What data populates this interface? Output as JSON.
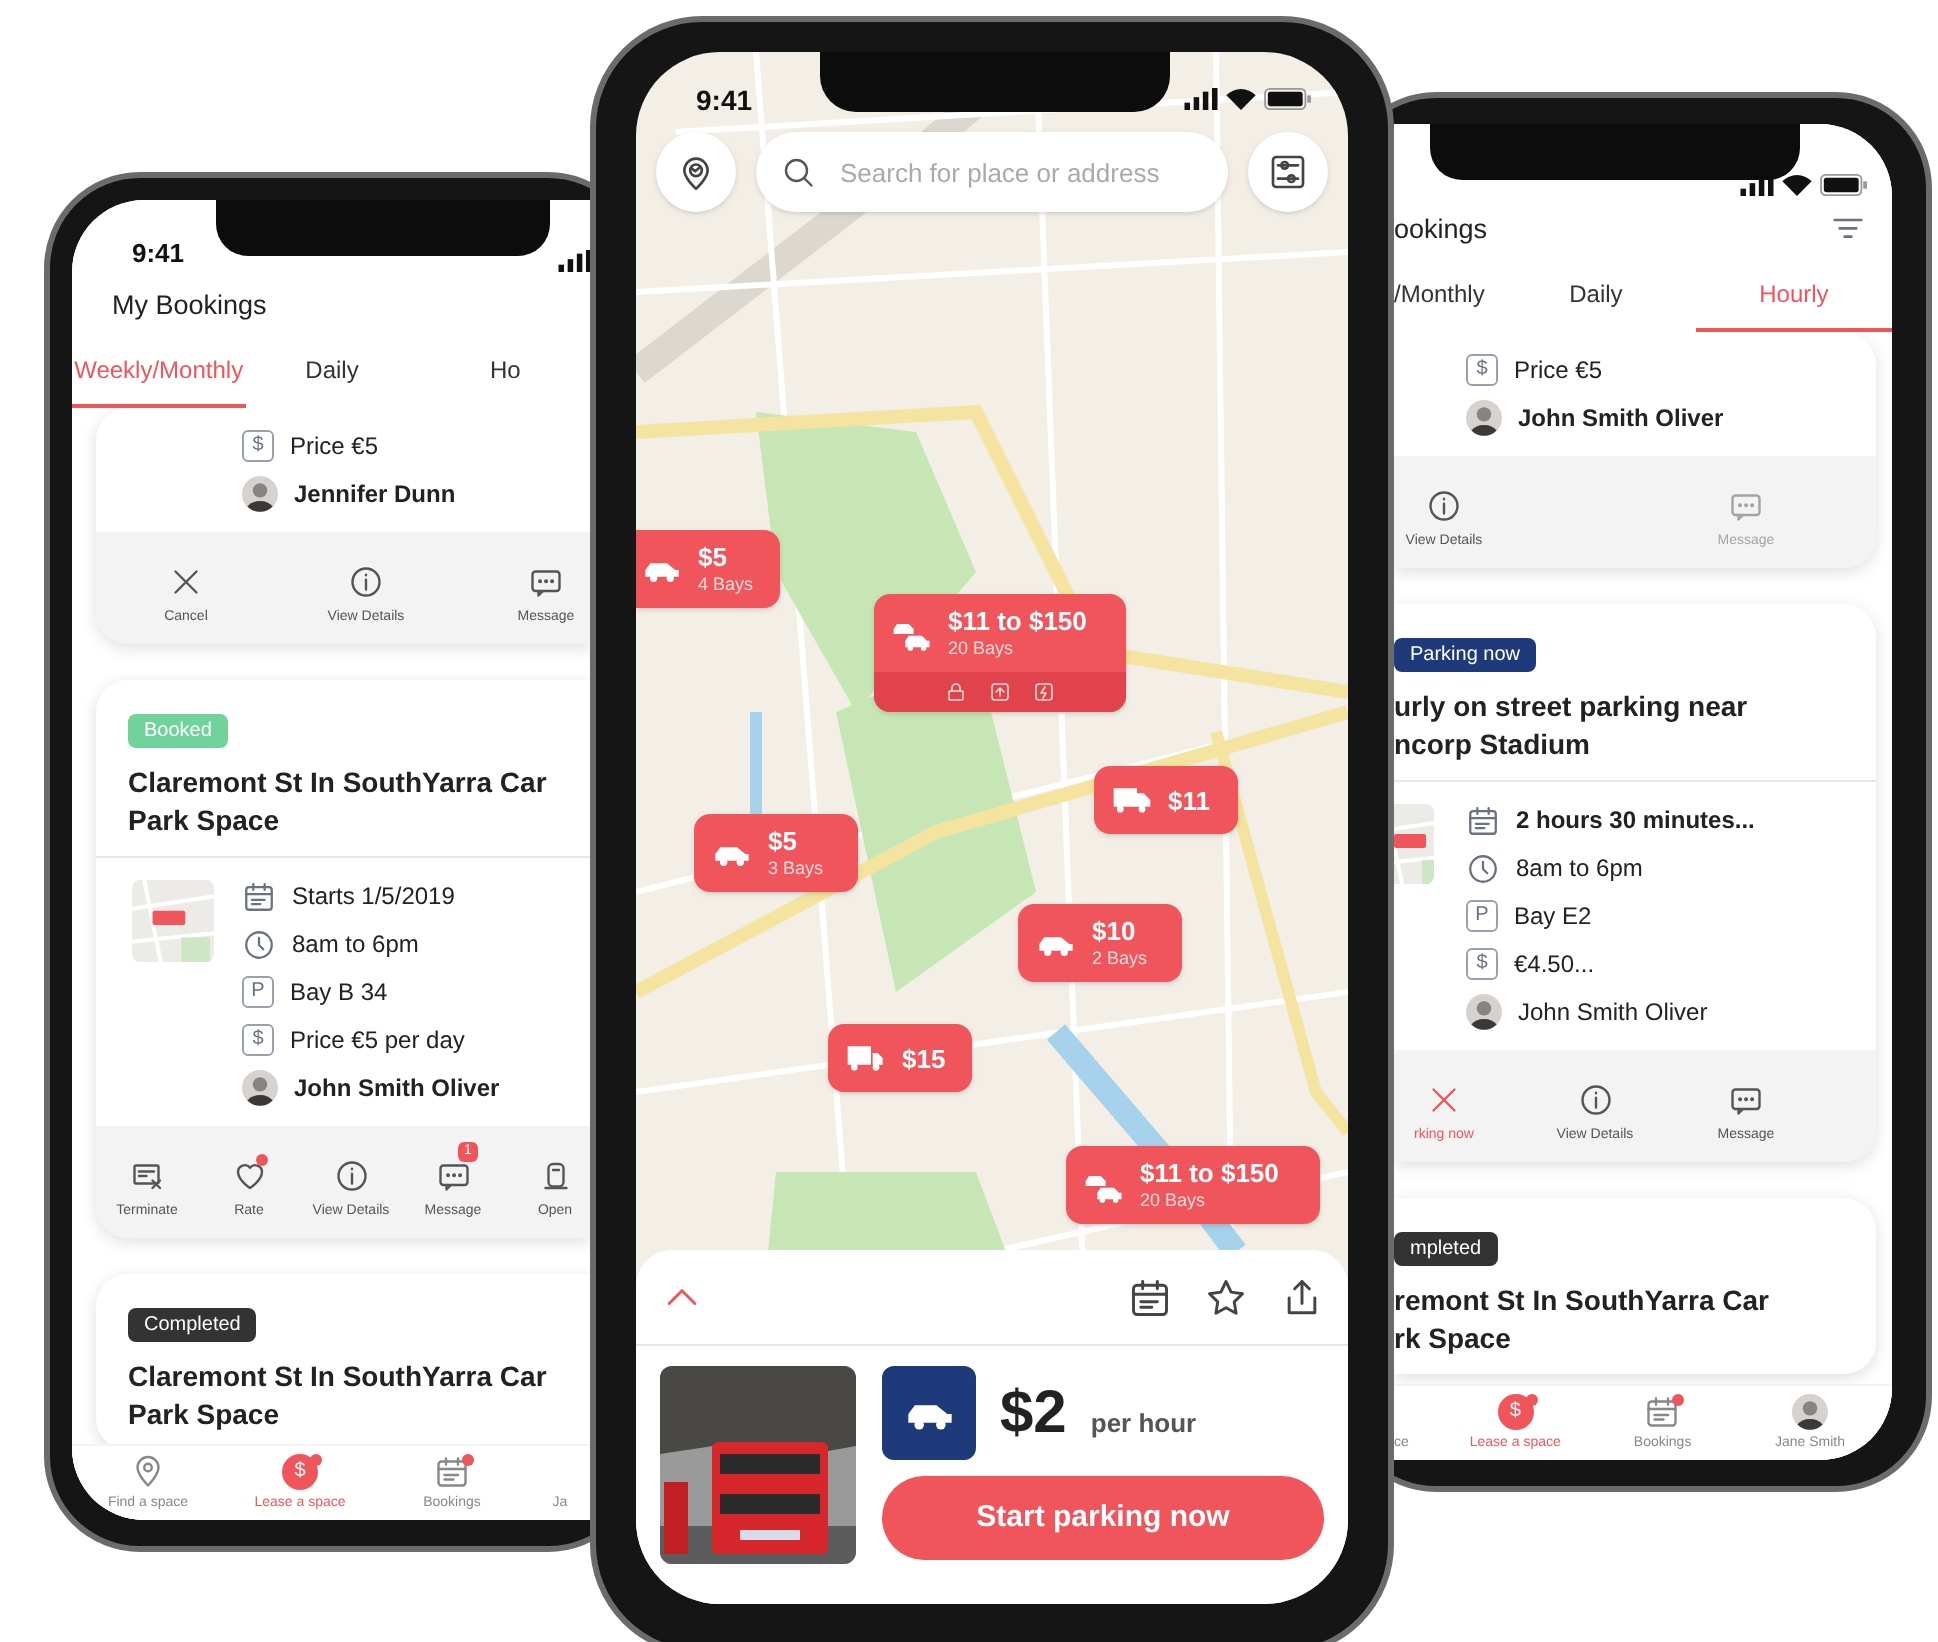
{
  "phones": [
    {
      "kind": "bookings",
      "status_time": "9:41",
      "title": "My Bookings",
      "tabs": [
        {
          "label": "Weekly/Monthly",
          "selected": true
        },
        {
          "label": "Daily",
          "selected": false
        },
        {
          "label": "Ho",
          "selected": false
        }
      ],
      "cards": [
        {
          "details": [
            {
              "kind": "sign",
              "glyph": "$",
              "text": "Price €5",
              "bold": false
            },
            {
              "kind": "person",
              "text": "Jennifer Dunn",
              "bold": true
            }
          ],
          "actions": [
            {
              "kind": "close",
              "label": "Cancel",
              "disabled": false,
              "highlighted": false,
              "dot": false
            },
            {
              "kind": "info",
              "label": "View Details",
              "disabled": false,
              "highlighted": false,
              "dot": false
            },
            {
              "kind": "message",
              "label": "Message",
              "disabled": false,
              "highlighted": false,
              "dot": false
            }
          ]
        },
        {
          "status": {
            "label": "Booked",
            "kind": "booked"
          },
          "title": [
            "Claremont St In SouthYarra Car",
            "Park Space"
          ],
          "thumbnail": {
            "kind": "picture"
          },
          "details": [
            {
              "kind": "calendar",
              "text": "Starts 1/5/2019",
              "bold": false
            },
            {
              "kind": "clock",
              "text": "8am to 6pm",
              "bold": false
            },
            {
              "kind": "sign",
              "glyph": "P",
              "text": "Bay B 34",
              "bold": false
            },
            {
              "kind": "sign",
              "glyph": "$",
              "text": "Price €5 per day",
              "bold": false
            },
            {
              "kind": "person",
              "text": "John Smith Oliver",
              "bold": true
            }
          ],
          "actions": [
            {
              "kind": "terminate",
              "label": "Terminate",
              "disabled": false,
              "highlighted": false,
              "dot": false
            },
            {
              "kind": "heart",
              "label": "Rate",
              "disabled": false,
              "highlighted": false,
              "dot": true
            },
            {
              "kind": "info",
              "label": "View Details",
              "disabled": false,
              "highlighted": false,
              "dot": false
            },
            {
              "kind": "message",
              "label": "Message",
              "disabled": false,
              "highlighted": false,
              "dot": false,
              "badge": "1"
            },
            {
              "kind": "barrier",
              "label": "Open",
              "disabled": false,
              "highlighted": false,
              "dot": false
            }
          ]
        },
        {
          "status": {
            "label": "Completed",
            "kind": "completed"
          },
          "title": [
            "Claremont St In SouthYarra Car",
            "Park Space"
          ]
        }
      ],
      "nav": [
        {
          "kind": "pin",
          "label": "Find a space",
          "selected": false,
          "dot": false
        },
        {
          "kind": "coin",
          "glyph": "$",
          "label": "Lease a space",
          "selected": true,
          "dot": true
        },
        {
          "kind": "bookings",
          "label": "Bookings",
          "selected": false,
          "dot": true
        },
        {
          "label": "Ja",
          "selected": false,
          "dot": false
        }
      ]
    },
    {
      "kind": "map",
      "status_time": "9:41",
      "search": {
        "placeholder": "Search for place or address"
      },
      "map": {
        "kind": "picture"
      },
      "markers": [
        {
          "kind": "car",
          "price": "$5",
          "bays": "4 Bays",
          "features": false
        },
        {
          "kind": "cars",
          "price": "$11 to $150",
          "bays": "20 Bays",
          "features": true
        },
        {
          "kind": "van",
          "price": "$11",
          "features": false
        },
        {
          "kind": "car",
          "price": "$5",
          "bays": "3 Bays",
          "features": false
        },
        {
          "kind": "car",
          "price": "$10",
          "bays": "2 Bays",
          "features": false
        },
        {
          "kind": "truck",
          "price": "$15",
          "features": false
        },
        {
          "kind": "cars",
          "price": "$11 to $150",
          "bays": "20 Bays",
          "features": false
        }
      ],
      "sheet": {
        "photo": {
          "kind": "picture"
        },
        "vehicle": {
          "kind": "car"
        },
        "price": "$2",
        "unit": "per hour",
        "button": "Start parking now"
      }
    },
    {
      "kind": "bookings",
      "title": "ookings",
      "filter_button": true,
      "tabs": [
        {
          "label": "/Monthly",
          "selected": false
        },
        {
          "label": "Daily",
          "selected": false
        },
        {
          "label": "Hourly",
          "selected": true
        }
      ],
      "cards": [
        {
          "details": [
            {
              "kind": "sign",
              "glyph": "$",
              "text": "Price €5",
              "bold": false
            },
            {
              "kind": "person",
              "text": "John Smith Oliver",
              "bold": true
            }
          ],
          "actions": [
            {
              "kind": "info",
              "label": "View Details",
              "disabled": false,
              "highlighted": false,
              "dot": false
            },
            {
              "kind": "message",
              "label": "Message",
              "disabled": true,
              "highlighted": false,
              "dot": false
            }
          ]
        },
        {
          "status": {
            "label": "Parking now",
            "kind": "parking"
          },
          "title": [
            "urly on street parking near",
            "ncorp Stadium"
          ],
          "thumbnail": {
            "kind": "picture"
          },
          "details": [
            {
              "kind": "calendar",
              "text": "2 hours 30 minutes...",
              "bold": true
            },
            {
              "kind": "clock",
              "text": "8am to 6pm",
              "bold": false
            },
            {
              "kind": "sign",
              "glyph": "P",
              "text": "Bay E2",
              "bold": false
            },
            {
              "kind": "sign",
              "glyph": "$",
              "text": "€4.50...",
              "bold": false
            },
            {
              "kind": "person",
              "text": "John Smith Oliver",
              "bold": false
            }
          ],
          "actions": [
            {
              "kind": "close",
              "label": "rking now",
              "disabled": false,
              "highlighted": true,
              "dot": false
            },
            {
              "kind": "info",
              "label": "View Details",
              "disabled": false,
              "highlighted": false,
              "dot": false
            },
            {
              "kind": "message",
              "label": "Message",
              "disabled": false,
              "highlighted": false,
              "dot": false
            }
          ]
        },
        {
          "status": {
            "label": "mpleted",
            "kind": "completed"
          },
          "title": [
            "remont St In SouthYarra Car",
            "rk Space"
          ]
        }
      ],
      "nav": [
        {
          "label": "ce",
          "selected": false,
          "dot": false
        },
        {
          "kind": "coin",
          "glyph": "$",
          "label": "Lease a space",
          "selected": true,
          "dot": true
        },
        {
          "kind": "bookings",
          "label": "Bookings",
          "selected": false,
          "dot": true
        },
        {
          "kind": "avatar",
          "label": "Jane Smith",
          "selected": false,
          "dot": false
        }
      ]
    }
  ]
}
